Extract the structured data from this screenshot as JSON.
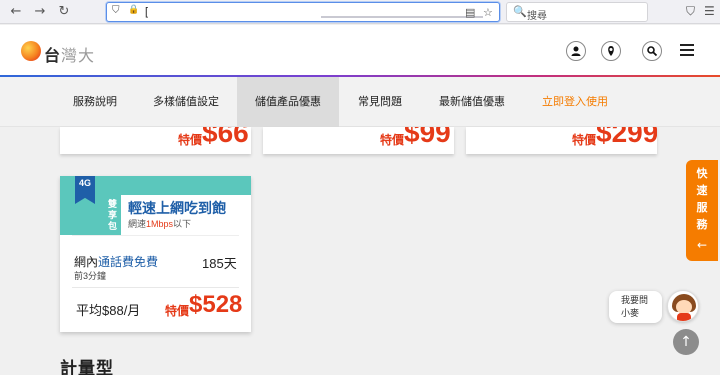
{
  "browser": {
    "url_text": "[",
    "search_placeholder": "搜尋",
    "icons": {
      "back": "←",
      "forward": "→",
      "reload": "↻",
      "shield": "⛉",
      "lock": "🔒",
      "reader": "▤",
      "bookmark": "☆",
      "search": "🔍",
      "pocket": "⛉",
      "menu": "☰"
    }
  },
  "header": {
    "logo_text_main": "台",
    "logo_text_fade": "灣大",
    "icons": {
      "user": "●",
      "location": "●",
      "search": "●"
    }
  },
  "subnav": {
    "items": [
      "服務說明",
      "多樣儲值設定",
      "儲值產品優惠",
      "常見問題",
      "最新儲值優惠",
      "立即登入使用"
    ],
    "active_index": 2
  },
  "top_cards": [
    {
      "special_label": "特價",
      "price": "$66"
    },
    {
      "special_label": "特價",
      "price": "$99"
    },
    {
      "special_label": "特價",
      "price": "$299"
    }
  ],
  "plan_card": {
    "ribbon": "4G",
    "tag": "雙享包",
    "title": "輕速上網吃到飽",
    "speed_prefix": "網速",
    "speed_value": "1Mbps",
    "speed_suffix": "以下",
    "feature_prefix": "網內",
    "feature_highlight": "通話費免費",
    "feature_sub": "前3分鐘",
    "days": "185天",
    "average": "平均$88/月",
    "special_label": "特價",
    "price": "$528"
  },
  "section_title": "計量型",
  "quick_service": {
    "label": "快速服務",
    "arrow": "←"
  },
  "chat": {
    "line1": "我要問",
    "line2": "小麥"
  },
  "to_top_icon": "↑",
  "colors": {
    "accent_orange": "#f57c00",
    "price_red": "#e53a18",
    "teal": "#5bc7bc",
    "brand_blue": "#1f5fa8"
  }
}
